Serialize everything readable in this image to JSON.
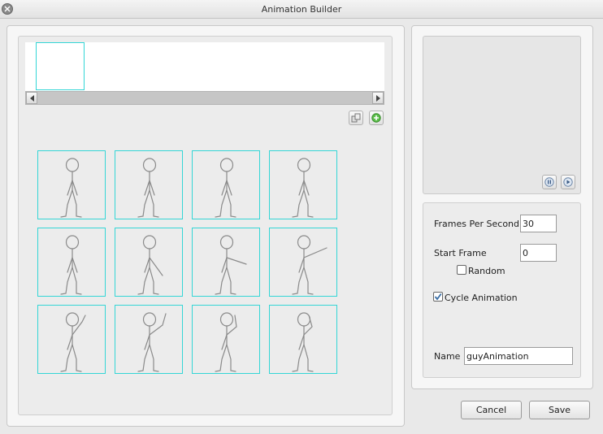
{
  "window": {
    "title": "Animation Builder"
  },
  "timeline": {
    "frame_count": 1
  },
  "toolbar": {
    "copy_icon": "copy-frame-icon",
    "add_icon": "add-frame-icon"
  },
  "frames": [
    {
      "pose": "stand"
    },
    {
      "pose": "stand"
    },
    {
      "pose": "stand"
    },
    {
      "pose": "stand"
    },
    {
      "pose": "stand"
    },
    {
      "pose": "arm-down-out"
    },
    {
      "pose": "arm-out"
    },
    {
      "pose": "arm-up-out"
    },
    {
      "pose": "arm-up"
    },
    {
      "pose": "arm-up-high"
    },
    {
      "pose": "arm-wave"
    },
    {
      "pose": "arm-wave-head"
    }
  ],
  "preview": {
    "pause_icon": "pause-icon",
    "play_icon": "play-icon"
  },
  "settings": {
    "fps_label": "Frames Per Second",
    "fps_value": "30",
    "start_frame_label": "Start Frame",
    "start_frame_value": "0",
    "random_label": "Random",
    "random_checked": false,
    "cycle_label": "Cycle Animation",
    "cycle_checked": true,
    "name_label": "Name",
    "name_value": "guyAnimation"
  },
  "buttons": {
    "cancel": "Cancel",
    "save": "Save"
  },
  "colors": {
    "frame_border": "#33d6d6",
    "sketch": "#8a8a8a",
    "check": "#3a6ea5"
  }
}
